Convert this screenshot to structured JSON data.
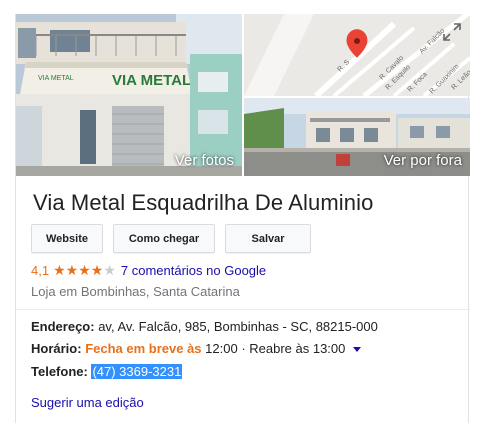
{
  "photos": {
    "main_label": "Ver fotos",
    "street_label": "Ver por fora",
    "storefront_sign": "VIA METAL",
    "map_streets": [
      "R. S",
      "R. Cavalo",
      "R. Esquilo",
      "R. Foca",
      "Av. Falcão",
      "R. Guaxinim",
      "R. Leão"
    ],
    "expand_icon": "expand-icon"
  },
  "business": {
    "title": "Via Metal Esquadrilha De Aluminio",
    "rating": "4,1",
    "rating_value": 4.1,
    "rating_max": 5,
    "reviews_label": "7 comentários no Google",
    "category": "Loja em Bombinhas, Santa Catarina"
  },
  "actions": {
    "website": "Website",
    "directions": "Como chegar",
    "save": "Salvar"
  },
  "info": {
    "address_label": "Endereço:",
    "address_value": "av, Av. Falcão, 985, Bombinhas - SC, 88215-000",
    "hours_label": "Horário:",
    "hours_status": "Fecha em breve às",
    "hours_value": "12:00 · Reabre às 13:00",
    "phone_label": "Telefone:",
    "phone_value": "(47) 3369-3231"
  },
  "footer": {
    "suggest_edit": "Sugerir uma edição"
  },
  "colors": {
    "accent_orange": "#e7711b",
    "link_blue": "#1a0dab",
    "selection_blue": "#3390ff",
    "map_pin_red": "#ea4335"
  }
}
